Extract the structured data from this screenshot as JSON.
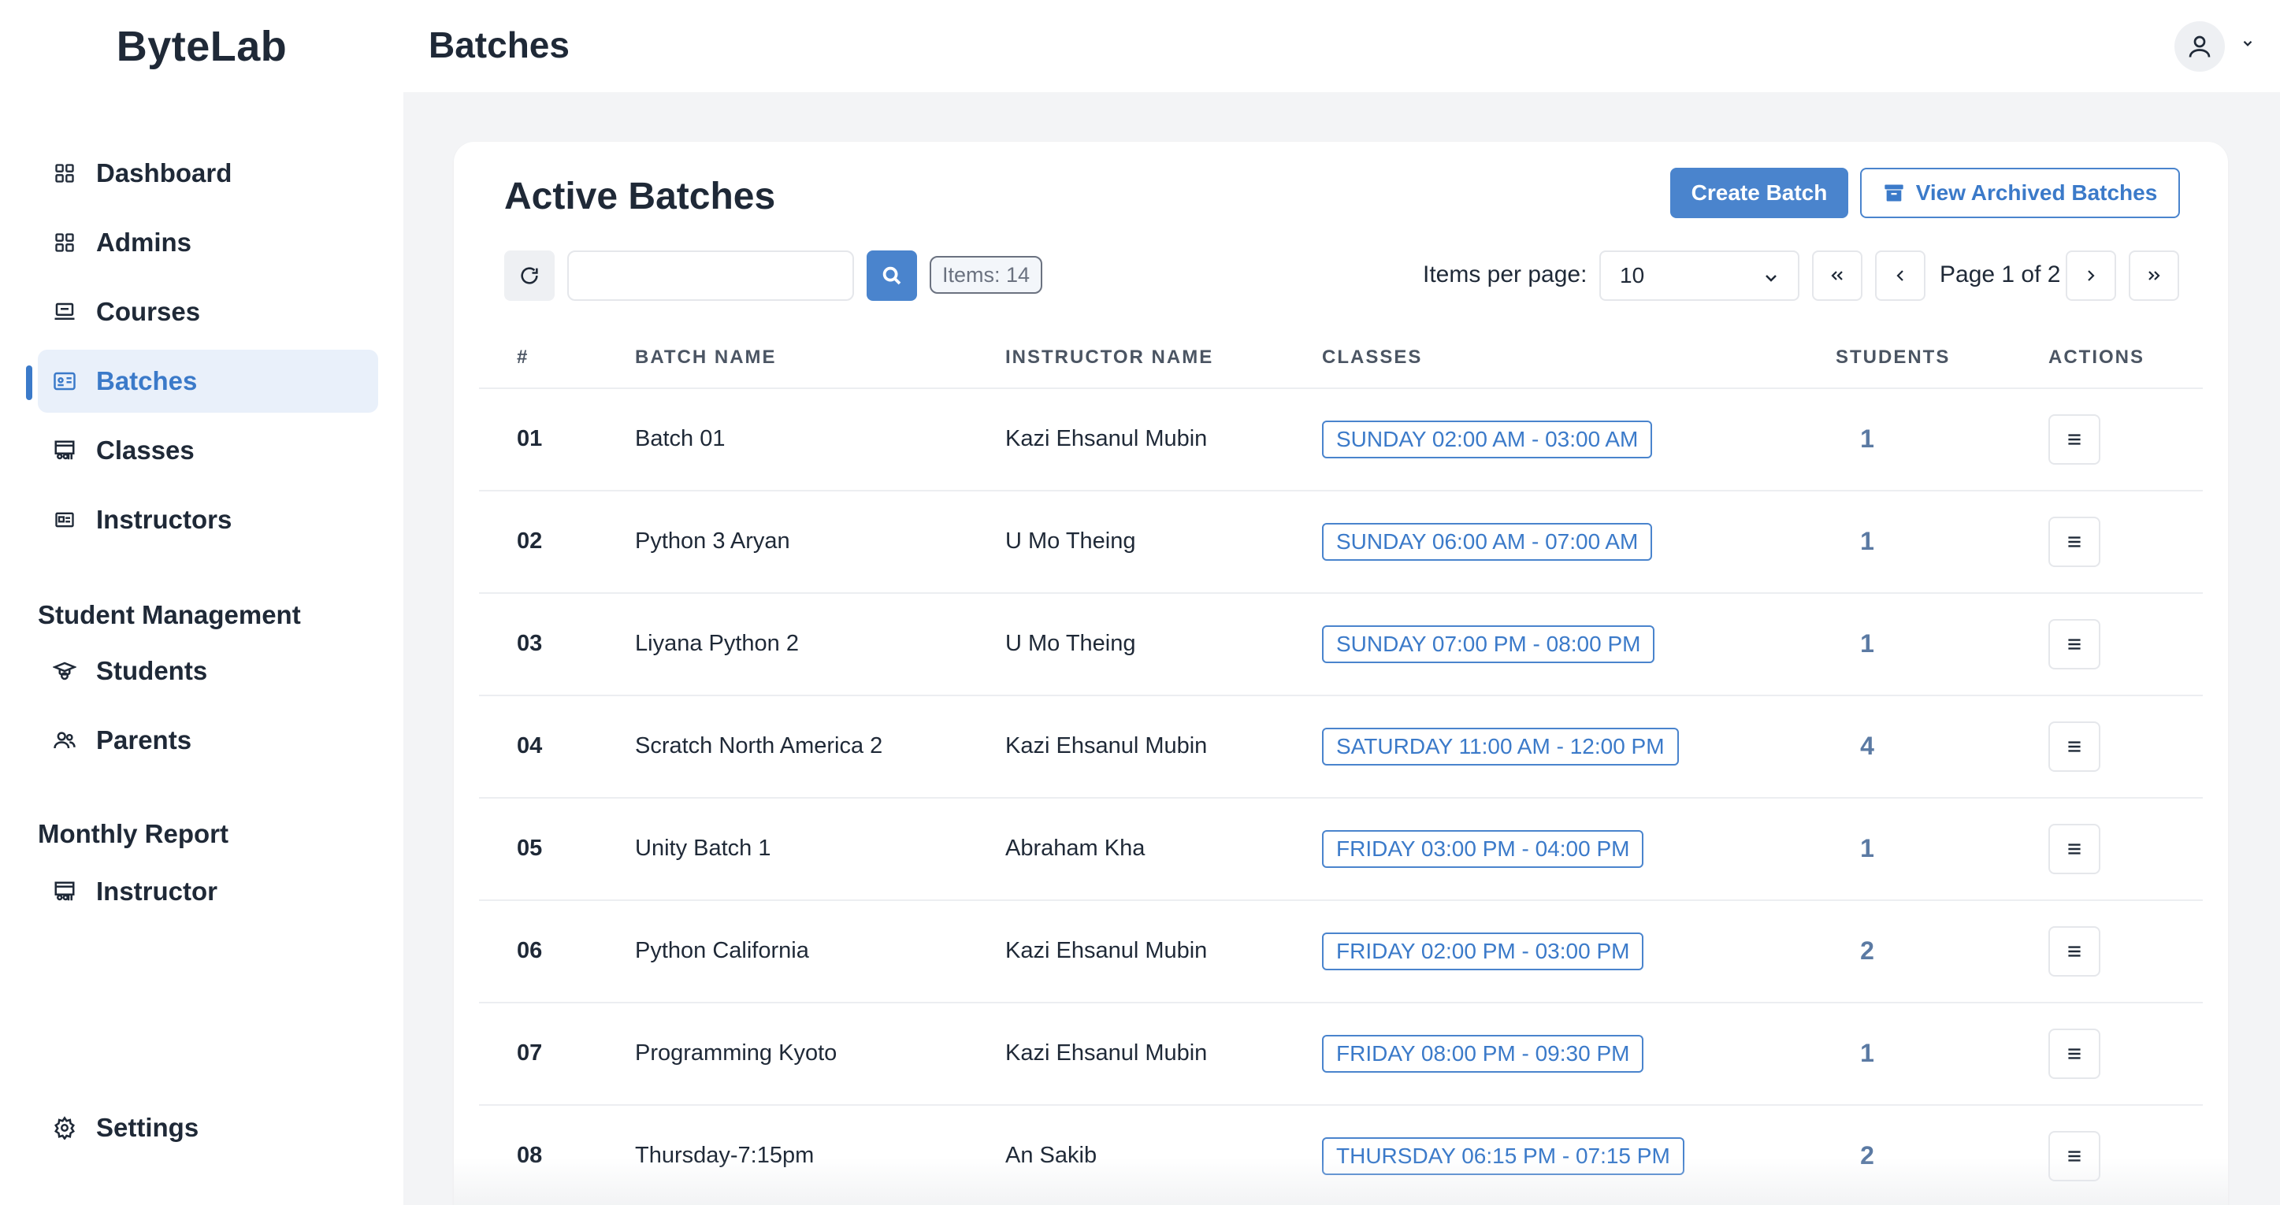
{
  "app": {
    "brand": "ByteLab",
    "page_title": "Batches"
  },
  "sidebar": {
    "items": [
      {
        "label": "Dashboard",
        "icon": "grid-icon"
      },
      {
        "label": "Admins",
        "icon": "grid-icon"
      },
      {
        "label": "Courses",
        "icon": "laptop-icon"
      },
      {
        "label": "Batches",
        "icon": "id-card-icon",
        "active": true
      },
      {
        "label": "Classes",
        "icon": "classroom-icon"
      },
      {
        "label": "Instructors",
        "icon": "id-badge-icon"
      }
    ],
    "student_section": {
      "title": "Student Management",
      "items": [
        {
          "label": "Students",
          "icon": "graduate-icon"
        },
        {
          "label": "Parents",
          "icon": "users-icon"
        }
      ]
    },
    "report_section": {
      "title": "Monthly Report",
      "items": [
        {
          "label": "Instructor",
          "icon": "classroom-icon"
        }
      ]
    },
    "settings_label": "Settings"
  },
  "card": {
    "title": "Active Batches",
    "create_label": "Create Batch",
    "archived_label": "View Archived Batches"
  },
  "toolbar": {
    "search_placeholder": "",
    "search_value": "",
    "items_badge": "Items: 14",
    "items_per_page_label": "Items per page:",
    "items_per_page_value": "10",
    "page_text": "Page 1 of 2"
  },
  "table": {
    "headers": [
      "#",
      "BATCH NAME",
      "INSTRUCTOR NAME",
      "CLASSES",
      "STUDENTS",
      "ACTIONS"
    ],
    "rows": [
      {
        "num": "01",
        "batch": "Batch 01",
        "instructor": "Kazi Ehsanul Mubin",
        "classes": "SUNDAY 02:00 AM - 03:00 AM",
        "students": "1"
      },
      {
        "num": "02",
        "batch": "Python 3 Aryan",
        "instructor": "U Mo Theing",
        "classes": "SUNDAY 06:00 AM - 07:00 AM",
        "students": "1"
      },
      {
        "num": "03",
        "batch": "Liyana Python 2",
        "instructor": "U Mo Theing",
        "classes": "SUNDAY 07:00 PM - 08:00 PM",
        "students": "1"
      },
      {
        "num": "04",
        "batch": "Scratch North America 2",
        "instructor": "Kazi Ehsanul Mubin",
        "classes": "SATURDAY 11:00 AM - 12:00 PM",
        "students": "4"
      },
      {
        "num": "05",
        "batch": "Unity Batch 1",
        "instructor": "Abraham Kha",
        "classes": "FRIDAY 03:00 PM - 04:00 PM",
        "students": "1"
      },
      {
        "num": "06",
        "batch": "Python California",
        "instructor": "Kazi Ehsanul Mubin",
        "classes": "FRIDAY 02:00 PM - 03:00 PM",
        "students": "2"
      },
      {
        "num": "07",
        "batch": "Programming Kyoto",
        "instructor": "Kazi Ehsanul Mubin",
        "classes": "FRIDAY 08:00 PM - 09:30 PM",
        "students": "1"
      },
      {
        "num": "08",
        "batch": "Thursday-7:15pm",
        "instructor": "An Sakib",
        "classes": "THURSDAY 06:15 PM - 07:15 PM",
        "students": "2"
      }
    ]
  },
  "colors": {
    "accent": "#4a84cd",
    "active_bg": "#e9f0fa",
    "page_bg": "#f3f4f6"
  }
}
